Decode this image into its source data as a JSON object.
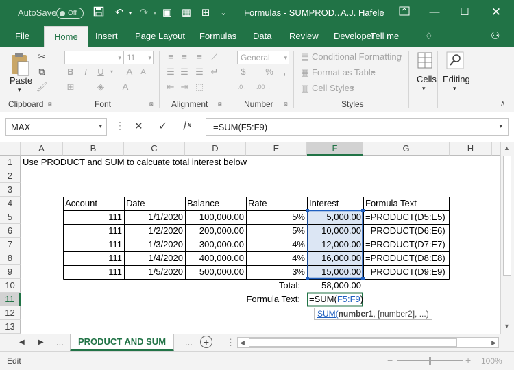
{
  "titlebar": {
    "autosave_label": "AutoSave",
    "autosave_state": "Off",
    "doc_title": "Formulas - SUMPROD...",
    "user": "A.J. Hafele"
  },
  "tabs": [
    "File",
    "Home",
    "Insert",
    "Page Layout",
    "Formulas",
    "Data",
    "Review",
    "Developer",
    "Tell me"
  ],
  "ribbon": {
    "clipboard": {
      "paste": "Paste",
      "label": "Clipboard"
    },
    "font": {
      "name": "",
      "size": "11",
      "label": "Font"
    },
    "alignment": {
      "label": "Alignment"
    },
    "number": {
      "format": "General",
      "label": "Number"
    },
    "styles": {
      "conditional": "Conditional Formatting",
      "table": "Format as Table",
      "cell": "Cell Styles",
      "label": "Styles"
    },
    "cells": "Cells",
    "editing": "Editing"
  },
  "formula_bar": {
    "name_box": "MAX",
    "fx": "fx",
    "formula": "=SUM(F5:F9)"
  },
  "columns": [
    "A",
    "B",
    "C",
    "D",
    "E",
    "F",
    "G",
    "H"
  ],
  "rows": [
    "1",
    "2",
    "3",
    "4",
    "5",
    "6",
    "7",
    "8",
    "9",
    "10",
    "11",
    "12",
    "13"
  ],
  "sheet": {
    "a1": "Use PRODUCT and SUM to calcuate total interest below",
    "headers": [
      "Account",
      "Date",
      "Balance",
      "Rate",
      "Interest",
      "Formula Text"
    ],
    "data": [
      [
        "111",
        "1/1/2020",
        "100,000.00",
        "5%",
        "5,000.00",
        "=PRODUCT(D5:E5)"
      ],
      [
        "111",
        "1/2/2020",
        "200,000.00",
        "5%",
        "10,000.00",
        "=PRODUCT(D6:E6)"
      ],
      [
        "111",
        "1/3/2020",
        "300,000.00",
        "4%",
        "12,000.00",
        "=PRODUCT(D7:E7)"
      ],
      [
        "111",
        "1/4/2020",
        "400,000.00",
        "4%",
        "16,000.00",
        "=PRODUCT(D8:E8)"
      ],
      [
        "111",
        "1/5/2020",
        "500,000.00",
        "3%",
        "15,000.00",
        "=PRODUCT(D9:E9)"
      ]
    ],
    "total_label": "Total:",
    "total_value": "58,000.00",
    "formula_text_label": "Formula Text:",
    "edit_prefix": "=SUM(",
    "edit_ref": "F5:F9",
    "edit_suffix": ")",
    "tooltip_fn": "SUM(",
    "tooltip_arg1": "number1",
    "tooltip_rest": ", [number2], ...)"
  },
  "sheet_tabs": {
    "ellipsis_left": "...",
    "active": "PRODUCT AND SUM",
    "ellipsis_right": "..."
  },
  "status": {
    "mode": "Edit",
    "zoom": "100%"
  },
  "colors": {
    "brand": "#217346",
    "ref": "#1f5fbf",
    "sel_fill": "#dce6f4"
  }
}
